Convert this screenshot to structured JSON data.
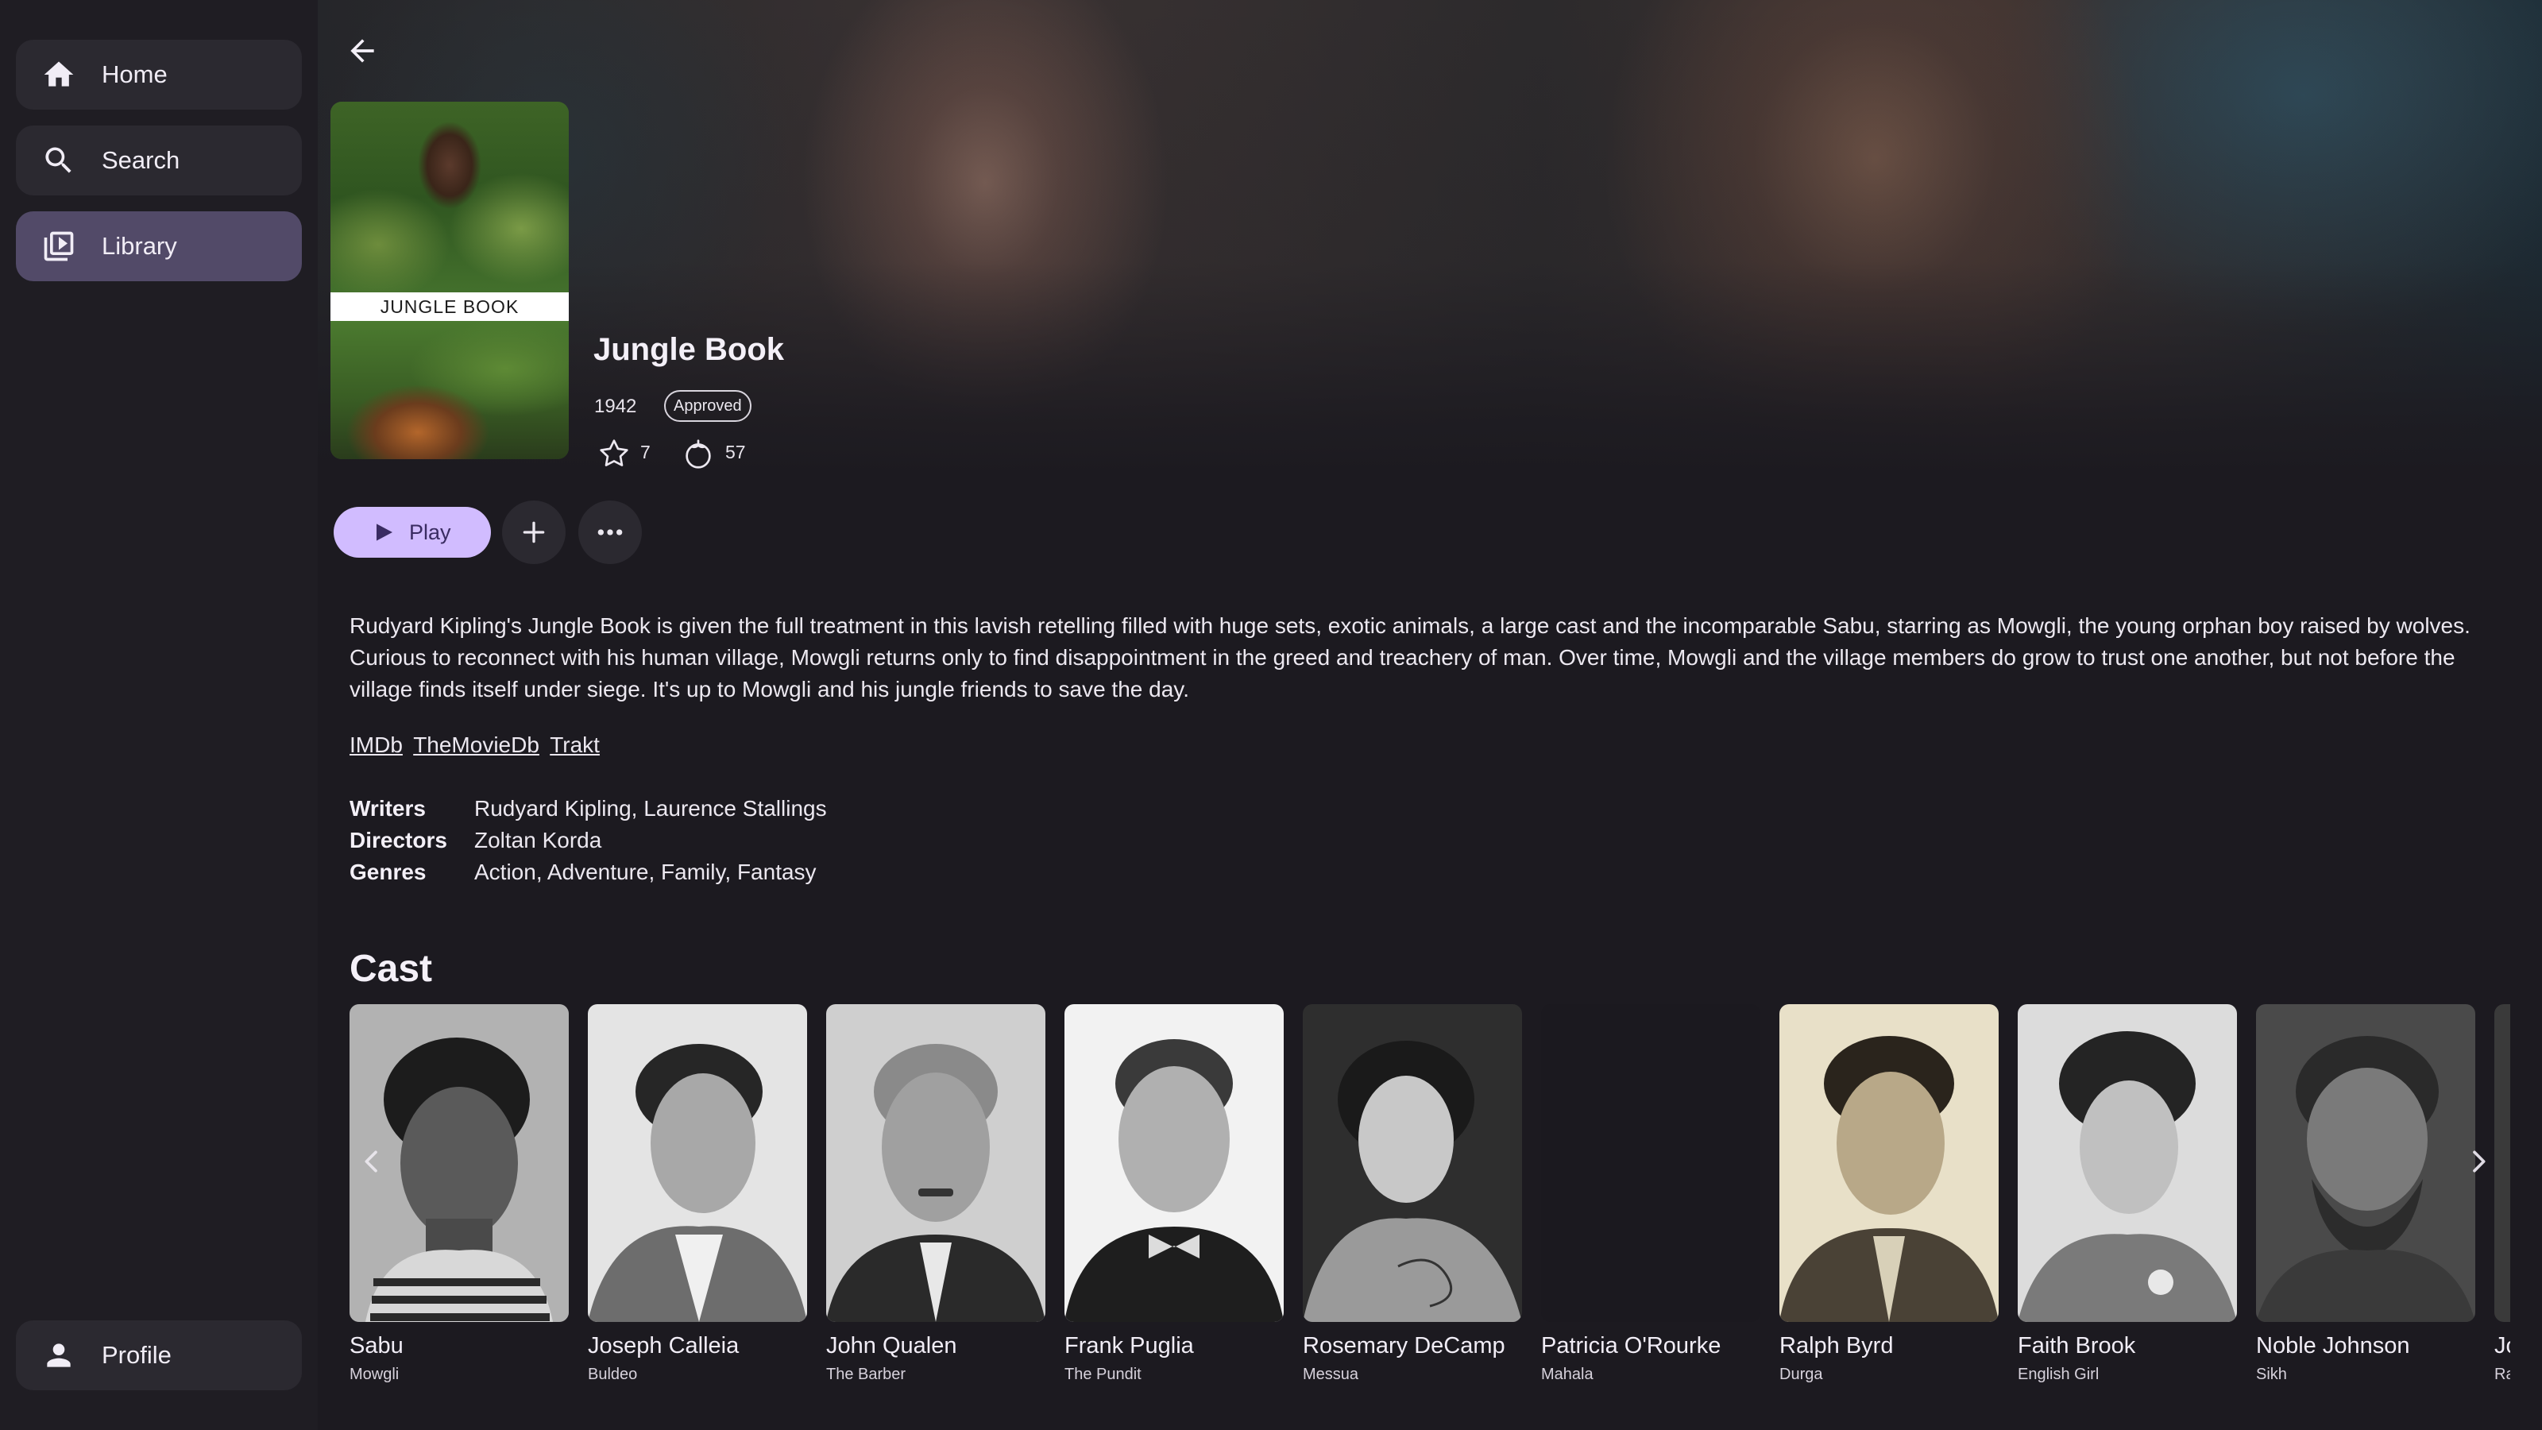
{
  "sidebar": {
    "items": [
      {
        "label": "Home",
        "icon": "home-icon"
      },
      {
        "label": "Search",
        "icon": "search-icon"
      },
      {
        "label": "Library",
        "icon": "library-icon",
        "active": true
      }
    ],
    "profile": {
      "label": "Profile",
      "icon": "person-icon"
    }
  },
  "movie": {
    "poster_text": "JUNGLE BOOK",
    "title": "Jungle Book",
    "year": "1942",
    "rating": "Approved",
    "community_rating": "7",
    "critic_rating": "57",
    "overview": "Rudyard Kipling's Jungle Book is given the full treatment in this lavish retelling filled with huge sets, exotic animals, a large cast and the incomparable Sabu, starring as Mowgli, the young orphan boy raised by wolves. Curious to reconnect with his human village, Mowgli returns only to find disappointment in the greed and treachery of man. Over time, Mowgli and the village members do grow to trust one another, but not before the village finds itself under siege. It's up to Mowgli and his jungle friends to save the day.",
    "links": [
      "IMDb",
      "TheMovieDb",
      "Trakt"
    ],
    "details": [
      {
        "key": "Writers",
        "value": "Rudyard Kipling, Laurence Stallings"
      },
      {
        "key": "Directors",
        "value": "Zoltan Korda"
      },
      {
        "key": "Genres",
        "value": "Action, Adventure, Family, Fantasy"
      }
    ]
  },
  "actions": {
    "play_label": "Play",
    "add_icon": "plus-icon",
    "more_icon": "more-horizontal-icon"
  },
  "cast": {
    "heading": "Cast",
    "members": [
      {
        "name": "Sabu",
        "role": "Mowgli"
      },
      {
        "name": "Joseph Calleia",
        "role": "Buldeo"
      },
      {
        "name": "John Qualen",
        "role": "The Barber"
      },
      {
        "name": "Frank Puglia",
        "role": "The Pundit"
      },
      {
        "name": "Rosemary DeCamp",
        "role": "Messua"
      },
      {
        "name": "Patricia O'Rourke",
        "role": "Mahala"
      },
      {
        "name": "Ralph Byrd",
        "role": "Durga"
      },
      {
        "name": "Faith Brook",
        "role": "English Girl"
      },
      {
        "name": "Noble Johnson",
        "role": "Sikh"
      },
      {
        "name": "Jo",
        "role": "Ra"
      }
    ]
  },
  "colors": {
    "accent": "#d1bcff",
    "active_nav": "#524a68",
    "background": "#1c1a20"
  }
}
